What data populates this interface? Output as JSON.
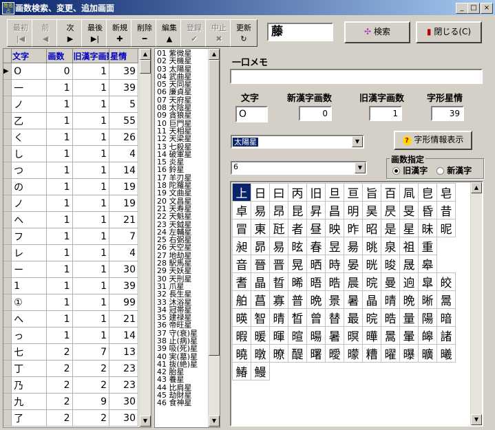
{
  "window": {
    "title": "画数検索、変更、追加画面",
    "icon_text": "姓名 占",
    "min_glyph": "_",
    "max_glyph": "□",
    "close_glyph": "×"
  },
  "toolbar": {
    "buttons": [
      {
        "label": "最初",
        "icon": "|◀",
        "enabled": false
      },
      {
        "label": "前",
        "icon": "◀",
        "enabled": false
      },
      {
        "label": "次",
        "icon": "▶",
        "enabled": true
      },
      {
        "label": "最後",
        "icon": "▶|",
        "enabled": true
      },
      {
        "label": "新規",
        "icon": "✚",
        "enabled": true
      },
      {
        "label": "削除",
        "icon": "━",
        "enabled": true
      },
      {
        "label": "編集",
        "icon": "▲",
        "enabled": true
      },
      {
        "label": "登録",
        "icon": "✔",
        "enabled": false
      },
      {
        "label": "中止",
        "icon": "✖",
        "enabled": false
      },
      {
        "label": "更新",
        "icon": "↻",
        "enabled": true
      }
    ],
    "search_value": "藤",
    "search_button_label": "検索",
    "close_button_label": "閉じる(C)"
  },
  "grid": {
    "headers": [
      "文字",
      "画数",
      "旧漢字画数",
      "星情"
    ],
    "rows": [
      {
        "char": "O",
        "kaku": "0",
        "old": "1",
        "star": "39",
        "current": true
      },
      {
        "char": "一",
        "kaku": "1",
        "old": "1",
        "star": "39"
      },
      {
        "char": "ノ",
        "kaku": "1",
        "old": "1",
        "star": "5"
      },
      {
        "char": "乙",
        "kaku": "1",
        "old": "1",
        "star": "55"
      },
      {
        "char": "く",
        "kaku": "1",
        "old": "1",
        "star": "26"
      },
      {
        "char": "し",
        "kaku": "1",
        "old": "1",
        "star": "4"
      },
      {
        "char": "つ",
        "kaku": "1",
        "old": "1",
        "star": "14"
      },
      {
        "char": "の",
        "kaku": "1",
        "old": "1",
        "star": "19"
      },
      {
        "char": "ノ",
        "kaku": "1",
        "old": "1",
        "star": "19"
      },
      {
        "char": "ヘ",
        "kaku": "1",
        "old": "1",
        "star": "21"
      },
      {
        "char": "フ",
        "kaku": "1",
        "old": "1",
        "star": "7"
      },
      {
        "char": "レ",
        "kaku": "1",
        "old": "1",
        "star": "4"
      },
      {
        "char": "ー",
        "kaku": "1",
        "old": "1",
        "star": "30"
      },
      {
        "char": "1",
        "kaku": "1",
        "old": "1",
        "star": "39"
      },
      {
        "char": "①",
        "kaku": "1",
        "old": "1",
        "star": "99"
      },
      {
        "char": "へ",
        "kaku": "1",
        "old": "1",
        "star": "21"
      },
      {
        "char": "っ",
        "kaku": "1",
        "old": "1",
        "star": "14"
      },
      {
        "char": "七",
        "kaku": "2",
        "old": "7",
        "star": "13"
      },
      {
        "char": "丁",
        "kaku": "2",
        "old": "2",
        "star": "23"
      },
      {
        "char": "乃",
        "kaku": "2",
        "old": "2",
        "star": "23"
      },
      {
        "char": "九",
        "kaku": "2",
        "old": "9",
        "star": "30"
      },
      {
        "char": "了",
        "kaku": "2",
        "old": "2",
        "star": "30"
      }
    ]
  },
  "star_list": [
    "01 紫微星",
    "02 天機星",
    "03 太陽星",
    "04 武曲星",
    "05 天同星",
    "06 廉貞星",
    "07 天府星",
    "08 太陰星",
    "09 貪狼星",
    "10 巨門星",
    "11 天相星",
    "12 天梁星",
    "13 七殺星",
    "14 破軍星",
    "15 炎星",
    "16 鈴星",
    "17 羊刃星",
    "18 陀羅星",
    "19 文曲星",
    "20 文昌星",
    "21 天寿星",
    "22 天魁星",
    "23 天鉞星",
    "24 左輔星",
    "25 右弼星",
    "26 天空星",
    "27 地劫星",
    "28 駅馬星",
    "29 天妖星",
    "30 天刑星",
    "31 爪星",
    "32 長生星",
    "33 沐浴星",
    "34 冠帯星",
    "35 建禄星",
    "36 帝旺星",
    "37 守(衰)星",
    "38 止(病)星",
    "39 吸(死)星",
    "40 実(墓)星",
    "41 抜(絶)星",
    "42 胎星",
    "43 養星",
    "44 比肩星",
    "45 劫財星",
    "46 食神星"
  ],
  "memo": {
    "label": "一口メモ",
    "value": ""
  },
  "fields": {
    "char_label": "文字",
    "char_value": "O",
    "new_label": "新漢字画数",
    "new_value": "0",
    "old_label": "旧漢字画数",
    "old_value": "1",
    "star_label": "字形星情",
    "star_value": "39"
  },
  "star_combo_value": "太陽星",
  "kaku_combo_value": "6",
  "info_button_label": "字形情報表示",
  "info_icon": "?",
  "kaku_group": {
    "label": "画数指定",
    "opt_old": "旧漢字",
    "opt_new": "新漢字",
    "selected": "old"
  },
  "kanji_rows": [
    [
      "上",
      "日",
      "曰",
      "丙",
      "旧",
      "旦",
      "亘",
      "旨",
      "百",
      "凬",
      "皀",
      "皂"
    ],
    [
      "卓",
      "易",
      "昂",
      "昆",
      "昇",
      "昌",
      "明",
      "昊",
      "昃",
      "旻",
      "昏",
      "昔"
    ],
    [
      "冒",
      "東",
      "瓩",
      "者",
      "昼",
      "映",
      "昨",
      "昭",
      "是",
      "星",
      "昧",
      "昵"
    ],
    [
      "昶",
      "昴",
      "易",
      "昡",
      "春",
      "昱",
      "昜",
      "晀",
      "泉",
      "祖",
      "重"
    ],
    [
      "音",
      "晉",
      "晋",
      "晃",
      "晒",
      "時",
      "晏",
      "晄",
      "晙",
      "晟",
      "皋"
    ],
    [
      "耆",
      "晶",
      "晢",
      "晞",
      "晤",
      "晧",
      "晨",
      "晥",
      "曼",
      "逈",
      "皐",
      "皎"
    ],
    [
      "舶",
      "菖",
      "寡",
      "普",
      "晩",
      "景",
      "暑",
      "晶",
      "晴",
      "晩",
      "晰",
      "暠"
    ],
    [
      "暎",
      "智",
      "晴",
      "晳",
      "曾",
      "替",
      "最",
      "晥",
      "晧",
      "量",
      "陽",
      "暗"
    ],
    [
      "暇",
      "暖",
      "暉",
      "暄",
      "暘",
      "暑",
      "暝",
      "曄",
      "暠",
      "暈",
      "皞",
      "諸"
    ],
    [
      "曉",
      "暾",
      "暸",
      "醍",
      "曙",
      "曖",
      "曚",
      "糟",
      "曜",
      "曝",
      "曠",
      "曦"
    ],
    [
      "鰆",
      "鰻"
    ]
  ]
}
